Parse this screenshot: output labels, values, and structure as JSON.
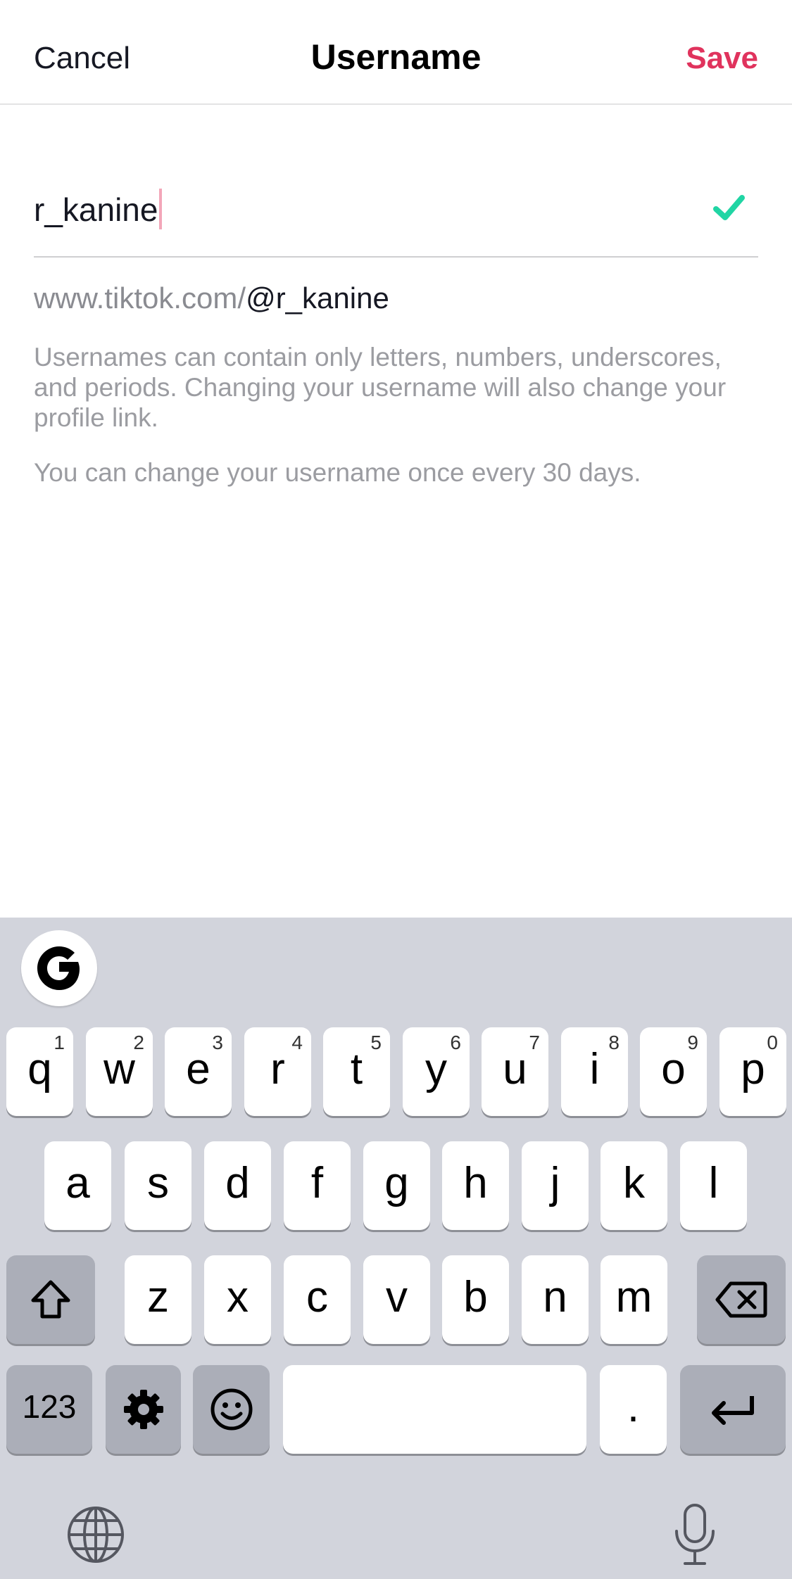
{
  "header": {
    "cancel_label": "Cancel",
    "title": "Username",
    "save_label": "Save"
  },
  "field": {
    "value": "r_kanine",
    "status_icon": "check-icon",
    "status_color": "#20d5a4"
  },
  "profile_link": {
    "prefix": "www.tiktok.com/",
    "handle": "@r_kanine"
  },
  "help_text": "Usernames can contain only letters, numbers, underscores, and periods. Changing your username will also change your profile link.",
  "limit_text": "You can change your username once every 30 days.",
  "colors": {
    "accent": "#e0335d",
    "keyboard_bg": "#d2d4dc"
  },
  "keyboard": {
    "row1": [
      {
        "key": "q",
        "hint": "1"
      },
      {
        "key": "w",
        "hint": "2"
      },
      {
        "key": "e",
        "hint": "3"
      },
      {
        "key": "r",
        "hint": "4"
      },
      {
        "key": "t",
        "hint": "5"
      },
      {
        "key": "y",
        "hint": "6"
      },
      {
        "key": "u",
        "hint": "7"
      },
      {
        "key": "i",
        "hint": "8"
      },
      {
        "key": "o",
        "hint": "9"
      },
      {
        "key": "p",
        "hint": "0"
      }
    ],
    "row2": [
      "a",
      "s",
      "d",
      "f",
      "g",
      "h",
      "j",
      "k",
      "l"
    ],
    "row3": [
      "z",
      "x",
      "c",
      "v",
      "b",
      "n",
      "m"
    ],
    "numbers_label": "123",
    "period_label": ".",
    "icons": [
      "google-g-icon",
      "shift-icon",
      "backspace-icon",
      "gear-icon",
      "emoji-icon",
      "return-icon",
      "globe-icon",
      "microphone-icon"
    ]
  }
}
